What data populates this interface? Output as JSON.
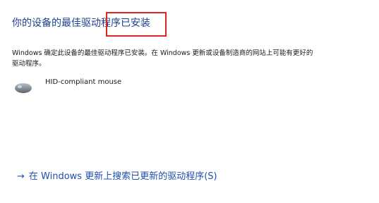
{
  "header": {
    "title": "你的设备的最佳驱动程序已安装"
  },
  "body": {
    "description": "Windows 确定此设备的最佳驱动程序已安装。在 Windows 更新或设备制造商的网站上可能有更好的驱动程序。"
  },
  "device": {
    "icon": "mouse-icon",
    "name": "HID-compliant mouse"
  },
  "actions": {
    "search_update_arrow": "→",
    "search_update_label": "在 Windows 更新上搜索已更新的驱动程序(S)"
  },
  "colors": {
    "title": "#1f3f8f",
    "link": "#1e4fb0",
    "highlight_border": "#e02424"
  }
}
